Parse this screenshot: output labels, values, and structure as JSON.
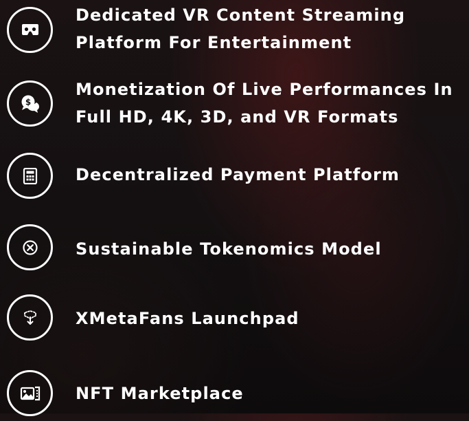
{
  "features": [
    {
      "icon": "vr-headset-icon",
      "lines": [
        "Dedicated VR Content Streaming",
        "Platform For Entertainment"
      ]
    },
    {
      "icon": "chat-money-icon",
      "lines": [
        "Monetization Of Live Performances In",
        "Full HD, 4K, 3D, and VR Formats"
      ]
    },
    {
      "icon": "calculator-icon",
      "lines": [
        "Decentralized Payment Platform"
      ]
    },
    {
      "icon": "circle-x-icon",
      "lines": [
        "Sustainable Tokenomics Model"
      ]
    },
    {
      "icon": "launch-box-icon",
      "lines": [
        "XMetaFans Launchpad"
      ]
    },
    {
      "icon": "gallery-icon",
      "lines": [
        "NFT Marketplace"
      ]
    }
  ],
  "colors": {
    "text": "#ffffff",
    "icon": "#ffffff",
    "background": "#120d0e",
    "glow": "#5c1a1c"
  }
}
